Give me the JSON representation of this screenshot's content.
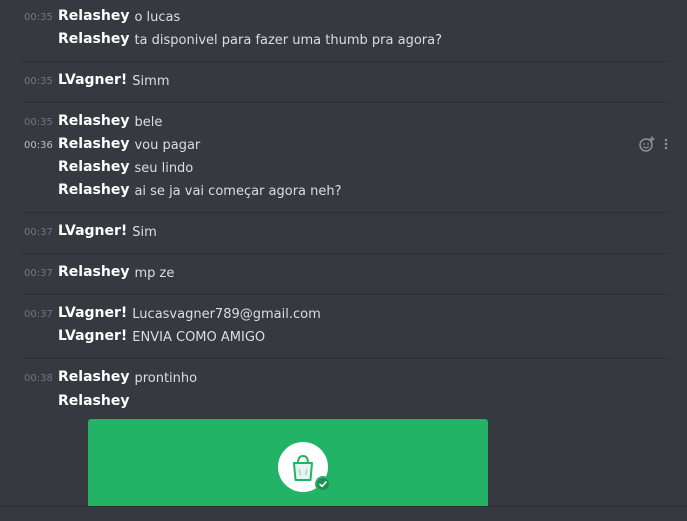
{
  "colors": {
    "background": "#36393f",
    "divider": "#2c2f33",
    "author": "#ffffff",
    "text": "#dcddde",
    "timestamp": "#72767d",
    "embed_bg": "#23b366",
    "icon": "#8e9297"
  },
  "messages": [
    {
      "time": "00:35",
      "author": "Relashey",
      "text": "o lucas"
    },
    {
      "time": "",
      "author": "Relashey",
      "text": "ta disponivel para fazer uma thumb pra agora?"
    },
    {
      "time": "00:35",
      "author": "LVagner!",
      "text": "Simm"
    },
    {
      "time": "00:35",
      "author": "Relashey",
      "text": "bele"
    },
    {
      "time": "00:36",
      "author": "Relashey",
      "text": "vou pagar"
    },
    {
      "time": "",
      "author": "Relashey",
      "text": "seu lindo"
    },
    {
      "time": "",
      "author": "Relashey",
      "text": "ai se ja vai começar agora neh?"
    },
    {
      "time": "00:37",
      "author": "LVagner!",
      "text": "Sim"
    },
    {
      "time": "00:37",
      "author": "Relashey",
      "text": "mp ze"
    },
    {
      "time": "00:37",
      "author": "LVagner!",
      "text": "Lucasvagner789@gmail.com"
    },
    {
      "time": "",
      "author": "LVagner!",
      "text": "ENVIA COMO AMIGO"
    },
    {
      "time": "00:38",
      "author": "Relashey",
      "text": "prontinho"
    },
    {
      "time": "",
      "author": "Relashey",
      "text": ""
    }
  ],
  "icons": {
    "add_reaction": "add-reaction-icon",
    "more": "more-options-icon",
    "embed_bag": "shopping-bag-icon",
    "embed_check": "check-badge-icon"
  }
}
